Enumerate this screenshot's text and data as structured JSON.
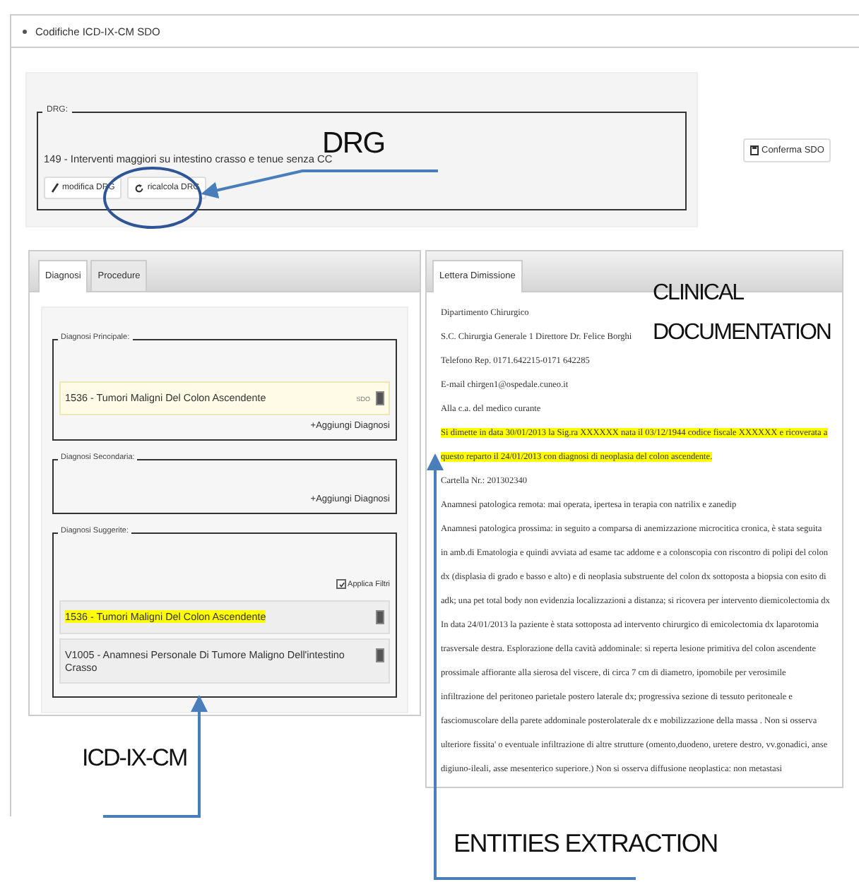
{
  "header": {
    "title": "Codifiche ICD-IX-CM SDO"
  },
  "drg": {
    "legend": "DRG:",
    "value": "149 - Interventi maggiori su intestino crasso e tenue senza CC",
    "buttons": [
      {
        "kind": "edit",
        "label": "modifica DRG"
      },
      {
        "kind": "recalculate",
        "label": "ricalcola DRG"
      }
    ]
  },
  "confirm_button": "Conferma SDO",
  "tabs": [
    {
      "label": "Diagnosi",
      "selected": true
    },
    {
      "label": "Procedure",
      "selected": false
    }
  ],
  "sections": [
    {
      "legend": "Diagnosi Principale:",
      "items": [
        {
          "kind": "assigned",
          "text": "1536 - Tumori Maligni Del Colon Ascendente",
          "tag": "SDO",
          "highlighted": false
        }
      ],
      "add_link": "+Aggiungi Diagnosi"
    },
    {
      "legend": "Diagnosi Secondaria:",
      "add_link": "+Aggiungi Diagnosi"
    },
    {
      "legend": "Diagnosi Suggerite:",
      "filter": {
        "label": "Applica Filtri",
        "checked": true
      },
      "items": [
        {
          "kind": "suggested",
          "text": "1536 - Tumori Maligni Del Colon Ascendente",
          "highlighted": true
        },
        {
          "kind": "suggested",
          "text": "V1005 - Anamnesi Personale Di Tumore Maligno Dell'intestino Crasso",
          "highlighted": false
        }
      ]
    }
  ],
  "letter": {
    "tab": "Lettera Dimissione",
    "paragraphs": [
      {
        "text": "Dipartimento Chirurgico",
        "highlighted": false
      },
      {
        "text": "S.C. Chirurgia Generale 1 Direttore Dr. Felice Borghi",
        "highlighted": false
      },
      {
        "text": "Telefono Rep. 0171.642215-0171 642285",
        "highlighted": false
      },
      {
        "text": "E-mail chirgen1@ospedale.cuneo.it",
        "highlighted": false
      },
      {
        "text": "Alla c.a. del medico curante",
        "highlighted": false
      },
      {
        "text": "Si dimette in data 30/01/2013 la Sig.ra XXXXXX nata il 03/12/1944 codice fiscale XXXXXX e ricoverata a questo reparto il 24/01/2013 con diagnosi di neoplasia del colon ascendente.",
        "highlighted": true
      },
      {
        "text": "Cartella Nr.: 201302340",
        "highlighted": false
      },
      {
        "text": "Anamnesi patologica remota: mai operata, ipertesa in terapia con natrilix e zanedip",
        "highlighted": false
      },
      {
        "text": "Anamnesi patologica prossima: in seguito a comparsa di anemizzazione microcitica cronica, è stata seguita in amb.di Ematologia e quindi avviata ad esame tac addome e a colonscopia con riscontro di polipi del colon dx (displasia di grado e basso e alto) e di neoplasia substruente del colon dx sottoposta a biopsia con esito di adk; una pet total body non evidenzia localizzazioni a distanza; si ricovera per intervento diemicolectomia dx",
        "highlighted": false
      },
      {
        "text": "In data 24/01/2013 la paziente è stata sottoposta ad intervento chirurgico di emicolectomia dx laparotomia trasversale destra. Esplorazione della cavità addominale: si reperta lesione primitiva del colon ascendente prossimale affiorante alla sierosa del viscere, di circa 7 cm di diametro, ipomobile per verosimile infiltrazione del peritoneo parietale postero laterale dx; progressiva sezione di tessuto peritoneale e fasciomuscolare della parete addominale posterolaterale dx e mobilizzazione della massa . Non si osserva ulteriore fissita' o eventuale infiltrazione di altre strutture (omento,duodeno, uretere destro, vv.gonadici, anse digiuno-ileali, asse mesenterico superiore.) Non si osserva diffusione neoplastica: non metastasi",
        "highlighted": false
      }
    ]
  },
  "annotations": [
    {
      "label": "DRG"
    },
    {
      "label": "CLINICAL DOCUMENTATION"
    },
    {
      "label": "ICD-IX-CM"
    },
    {
      "label": "ENTITIES EXTRACTION"
    }
  ]
}
